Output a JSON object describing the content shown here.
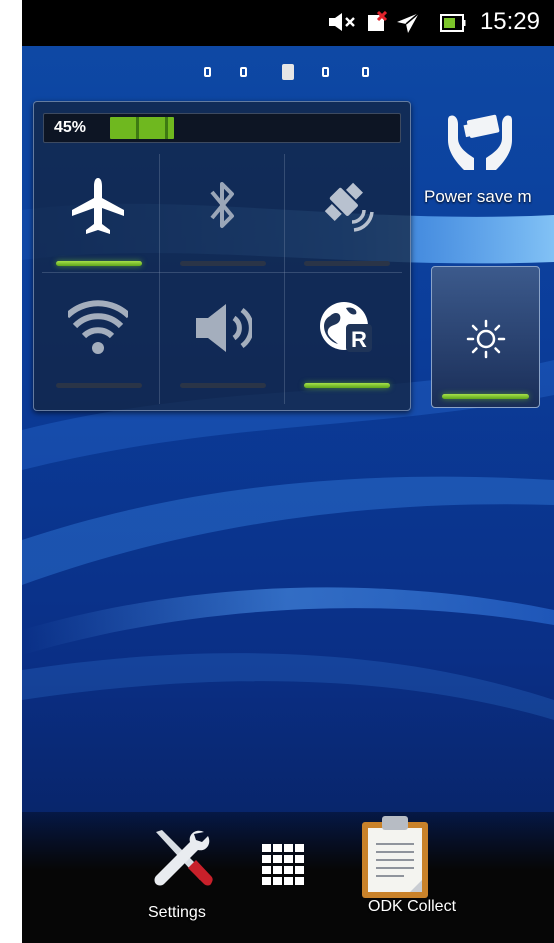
{
  "status_bar": {
    "time": "15:29",
    "icons": [
      "mute-icon",
      "no-sim-icon",
      "airplane-mode-icon",
      "battery-icon"
    ]
  },
  "home": {
    "page_indicator": {
      "count": 5,
      "active_index": 2
    }
  },
  "power_widget": {
    "battery_percent_label": "45%",
    "battery_level": 0.45,
    "toggles": [
      {
        "name": "airplane-mode",
        "icon": "airplane-icon",
        "on": true
      },
      {
        "name": "bluetooth",
        "icon": "bluetooth-icon",
        "on": false
      },
      {
        "name": "gps",
        "icon": "gps-satellite-icon",
        "on": false
      },
      {
        "name": "wifi",
        "icon": "wifi-icon",
        "on": false
      },
      {
        "name": "sound",
        "icon": "speaker-icon",
        "on": false
      },
      {
        "name": "data-roaming",
        "icon": "roaming-globe-icon",
        "on": true
      }
    ],
    "accent_color": "#7cc42a"
  },
  "power_save": {
    "label": "Power save m",
    "icon": "power-save-hands-icon"
  },
  "brightness": {
    "icon": "sun-icon",
    "on": true
  },
  "dock": {
    "items": [
      {
        "label": "Settings",
        "icon": "settings-tools-icon"
      },
      {
        "label": "",
        "icon": "app-grid-icon"
      },
      {
        "label": "ODK Collect",
        "icon": "clipboard-icon"
      }
    ]
  }
}
